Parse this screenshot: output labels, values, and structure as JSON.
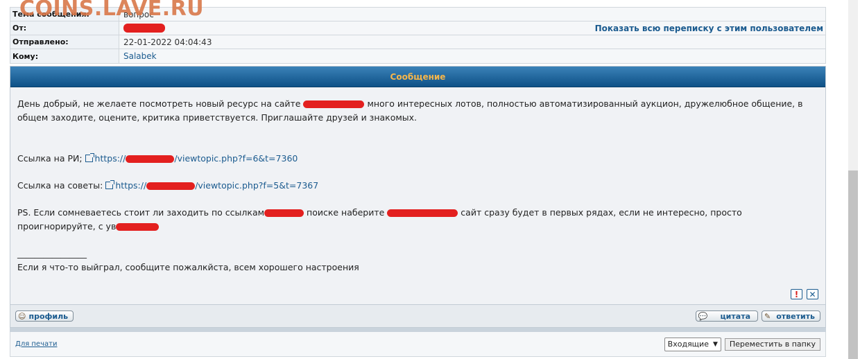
{
  "watermark": "COINS.LAVE.RU",
  "header": {
    "subject_label": "Тема сообщения:",
    "subject_value": "вопрос",
    "from_label": "От:",
    "show_all_link": "Показать всю переписку с этим пользователем",
    "sent_label": "Отправлено:",
    "sent_value": "22-01-2022 04:04:43",
    "to_label": "Кому:",
    "to_value": "Salabek"
  },
  "message": {
    "title": "Сообщение",
    "p1_a": "День добрый, не желаете посмотреть новый ресурс на сайте",
    "p1_b": "много интересных лотов, полностью автоматизированный аукцион, дружелюбное общение, в общем заходите, оцените, критика приветствуется. Приглашайте друзей и знакомых.",
    "link1_label": "Ссылка на РИ;",
    "link1_prefix": "https://",
    "link1_suffix": "/viewtopic.php?f=6&t=7360",
    "link2_label": "Ссылка на советы:",
    "link2_prefix": "https://",
    "link2_suffix": "/viewtopic.php?f=5&t=7367",
    "ps_a": "PS. Если сомневаетесь стоит ли заходить по ссылкам",
    "ps_b": "поиске наберите",
    "ps_c": "сайт сразу будет в первых рядах, если не интересно, просто проигнорируйте, с ув",
    "signature_line": "________________",
    "signature_text": "Если я что-то выйграл, сообщите пожалкйста, всем хорошего настроения",
    "report_icon": "!",
    "delete_icon": "✕"
  },
  "footer": {
    "profile_button": "профиль",
    "quote_button": "цитата",
    "reply_button": "ответить"
  },
  "bottom": {
    "print_link": "Для печати",
    "folder_select": "Входящие",
    "move_button": "Переместить в папку"
  }
}
